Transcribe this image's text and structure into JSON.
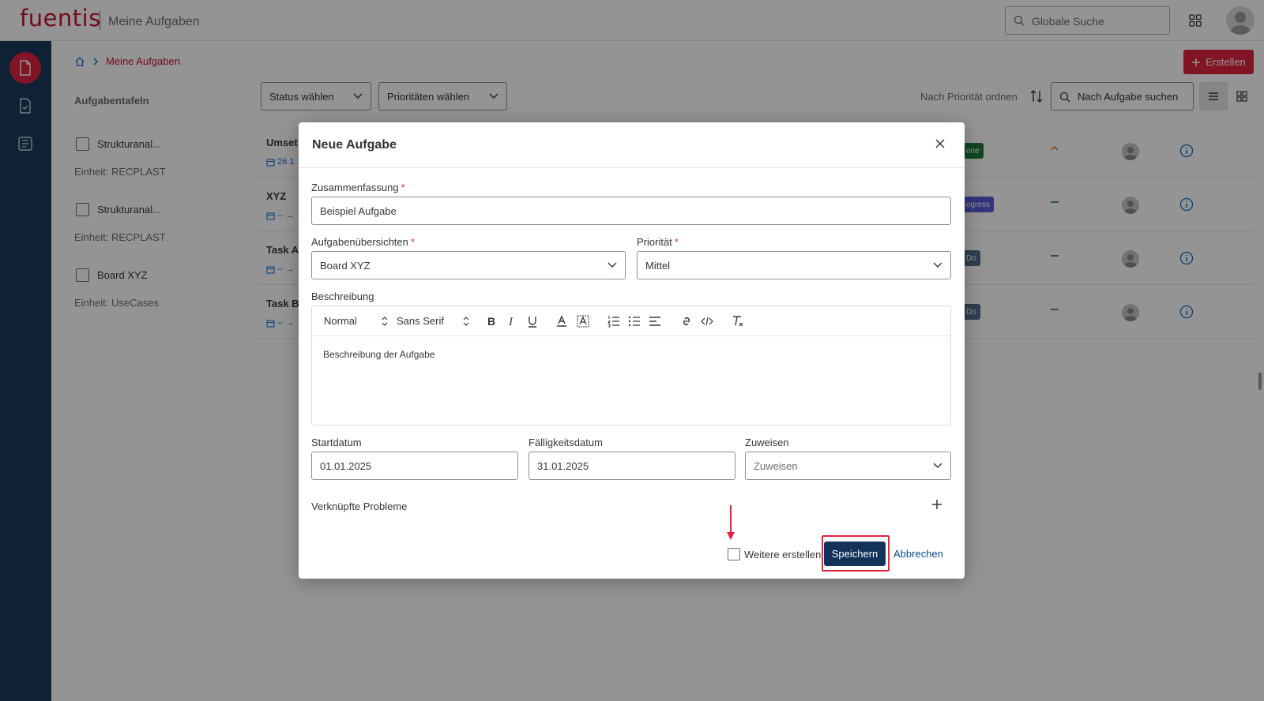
{
  "header": {
    "logo": "fuentis",
    "app_title": "Meine Aufgaben",
    "global_search_placeholder": "Globale Suche"
  },
  "breadcrumb": {
    "current": "Meine Aufgaben"
  },
  "create_button": "Erstellen",
  "sidebar": {
    "heading": "Aufgabentafeln",
    "boards": [
      {
        "name": "Strukturanal...",
        "unit": "Einheit: RECPLAST"
      },
      {
        "name": "Strukturanal...",
        "unit": "Einheit: RECPLAST"
      },
      {
        "name": "Board XYZ",
        "unit": "Einheit: UseCases"
      }
    ]
  },
  "filters": {
    "status": "Status wählen",
    "priority": "Prioritäten wählen",
    "sort_label": "Nach Priorität ordnen",
    "search_placeholder": "Nach Aufgabe suchen"
  },
  "tasks": [
    {
      "title": "Umset",
      "dates": "26.1",
      "status": "one",
      "status_color": "#1e7b34"
    },
    {
      "title": "XYZ",
      "dates": "-- →",
      "status": "ogress",
      "status_color": "#5b5bd6"
    },
    {
      "title": "Task A",
      "dates": "-- →",
      "status": "Do",
      "status_color": "#516b8a"
    },
    {
      "title": "Task B",
      "dates": "-- →",
      "status": "Do",
      "status_color": "#516b8a"
    }
  ],
  "dialog": {
    "title": "Neue Aufgabe",
    "summary_label": "Zusammenfassung",
    "summary_value": "Beispiel Aufgabe",
    "boards_label": "Aufgabenübersichten",
    "boards_value": "Board XYZ",
    "priority_label": "Priorität",
    "priority_value": "Mittel",
    "description_label": "Beschreibung",
    "toolbar": {
      "style": "Normal",
      "font": "Sans Serif"
    },
    "description_text": "Beschreibung der Aufgabe",
    "start_label": "Startdatum",
    "start_value": "01.01.2025",
    "due_label": "Fälligkeitsdatum",
    "due_value": "31.01.2025",
    "assign_label": "Zuweisen",
    "assign_placeholder": "Zuweisen",
    "linked_label": "Verknüpfte Probleme",
    "more_label": "Weitere erstellen",
    "save_label": "Speichern",
    "cancel_label": "Abbrechen",
    "required_mark": "*"
  },
  "colors": {
    "brand_red": "#e1253f",
    "nav_blue": "#1b3a5c",
    "save_blue": "#12325a"
  }
}
